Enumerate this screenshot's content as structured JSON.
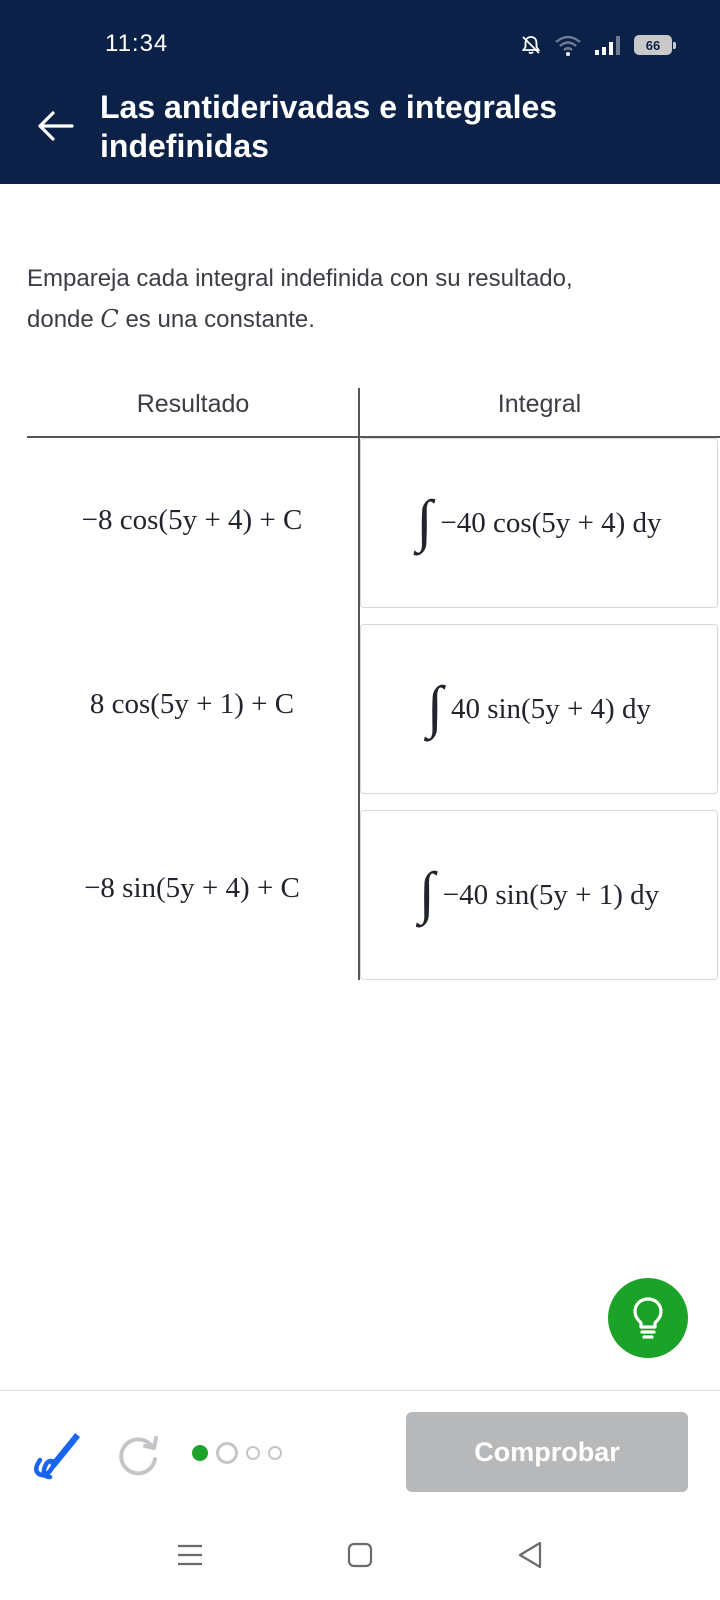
{
  "status": {
    "time": "11:34",
    "battery": "66",
    "icons": [
      "mute-icon",
      "wifi-icon",
      "signal-icon",
      "battery-icon"
    ]
  },
  "header": {
    "title": "Las antiderivadas e integrales indefinidas",
    "back_icon": "arrow-left-icon"
  },
  "prompt": {
    "text_before": "Empareja cada integral indefinida con su resultado, donde ",
    "variable": "C",
    "text_after": " es una constante."
  },
  "table": {
    "headers": {
      "left": "Resultado",
      "right": "Integral"
    },
    "results": [
      "−8 cos(5y + 4) + C",
      "8 cos(5y + 1) + C",
      "−8 sin(5y + 4) + C"
    ],
    "integrals": [
      {
        "sign": "∫",
        "expr": "−40 cos(5y + 4) dy"
      },
      {
        "sign": "∫",
        "expr": "40 sin(5y + 4) dy"
      },
      {
        "sign": "∫",
        "expr": "−40 sin(5y + 1) dy"
      }
    ]
  },
  "toolbar": {
    "hint_icon": "lightbulb-icon",
    "pen_icon": "pen-icon",
    "redo_icon": "redo-icon",
    "progress": {
      "total": 4,
      "current": 1
    },
    "check_label": "Comprobar"
  },
  "colors": {
    "header_bg": "#0c2148",
    "hint_green": "#1aa328",
    "progress_green": "#1aa328",
    "pen_blue": "#1865f2",
    "check_disabled": "#b6b8ba"
  },
  "nav": {
    "icons": [
      "menu-icon",
      "home-icon",
      "back-triangle-icon"
    ]
  }
}
